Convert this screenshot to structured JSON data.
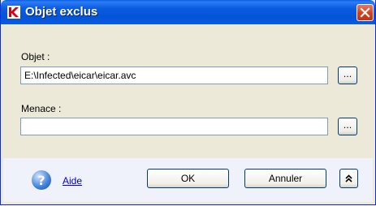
{
  "window": {
    "title": "Objet exclus",
    "app_icon": "kaspersky-k-icon",
    "close_icon": "close-icon"
  },
  "form": {
    "object_label": "Objet :",
    "object_value": "E:\\Infected\\eicar\\eicar.avc",
    "object_browse_label": "...",
    "threat_label": "Menace :",
    "threat_value": "",
    "threat_browse_label": "..."
  },
  "footer": {
    "help_icon": "help-icon",
    "help_label": "Aide",
    "ok_label": "OK",
    "cancel_label": "Annuler",
    "collapse_icon": "double-chevron-up-icon"
  },
  "colors": {
    "titlebar": "#0a5be0",
    "close_button": "#d4401c",
    "dialog_background": "#ece9d8",
    "footer_background": "#f0f2fb",
    "link": "#0000cc"
  }
}
